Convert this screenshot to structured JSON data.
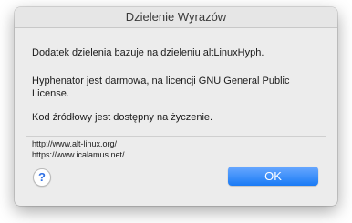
{
  "window": {
    "title": "Dzielenie Wyrazów"
  },
  "content": {
    "paragraph1": "Dodatek dzielenia bazuje na dzieleniu altLinuxHyph.",
    "paragraph2": "Hyphenator jest darmowa, na licencji GNU General Public License.",
    "paragraph3": "Kod źródłowy jest dostępny na życzenie."
  },
  "links": [
    "http://www.alt-linux.org/",
    "https://www.icalamus.net/"
  ],
  "buttons": {
    "help_label": "?",
    "ok_label": "OK"
  },
  "colors": {
    "accent": "#1a7bf5",
    "help_glyph": "#2f6fe4"
  },
  "icons": {
    "help": "help-icon"
  }
}
